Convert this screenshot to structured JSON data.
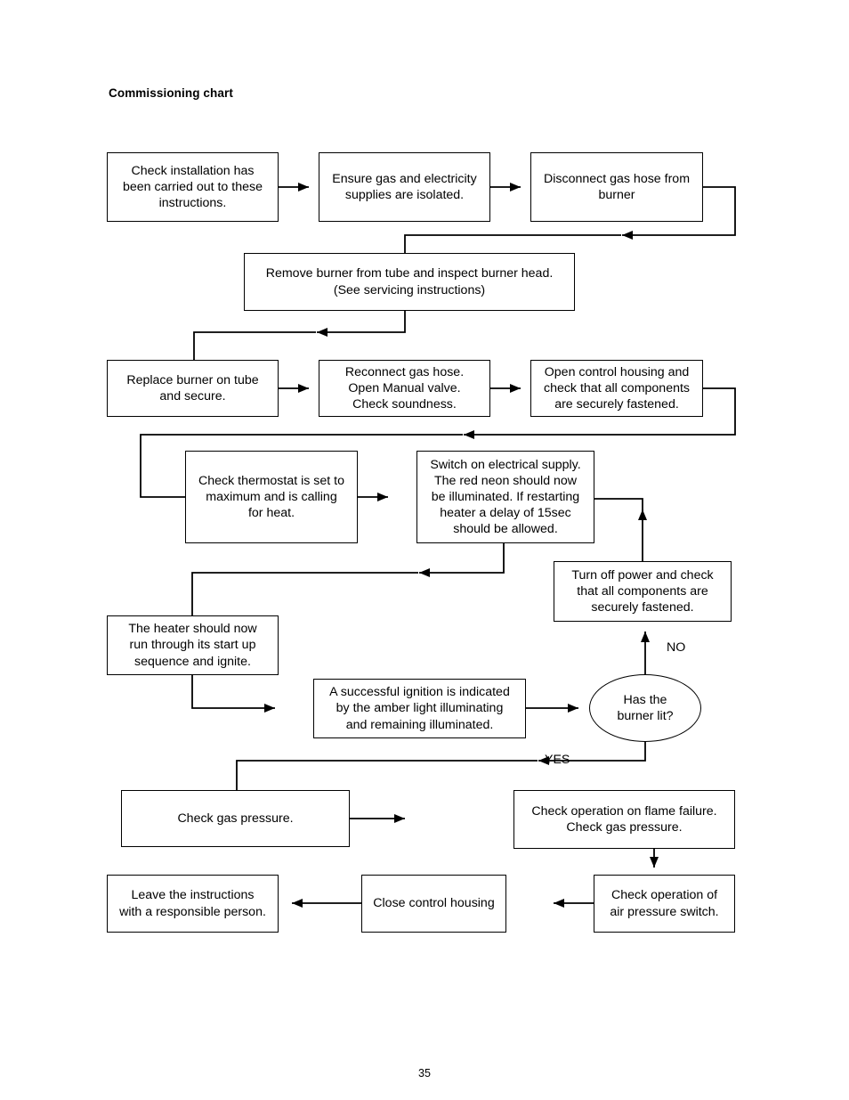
{
  "document": {
    "title": "Commissioning chart",
    "page_number": "35"
  },
  "chart_data": {
    "type": "diagram",
    "diagram_kind": "flowchart",
    "title": "Commissioning chart",
    "orientation": "top-to-bottom, serpentine rows",
    "nodes": [
      {
        "id": "n1",
        "shape": "process",
        "text": "Check installation has\nbeen carried out to these\ninstructions."
      },
      {
        "id": "n2",
        "shape": "process",
        "text": "Ensure gas and electricity\nsupplies are isolated."
      },
      {
        "id": "n3",
        "shape": "process",
        "text": "Disconnect gas hose from\nburner"
      },
      {
        "id": "n4",
        "shape": "process",
        "text": "Remove burner from tube and inspect burner head.\n(See servicing instructions)"
      },
      {
        "id": "n5",
        "shape": "process",
        "text": "Replace burner on tube\nand secure."
      },
      {
        "id": "n6",
        "shape": "process",
        "text": "Reconnect gas hose.\nOpen Manual valve.\nCheck soundness."
      },
      {
        "id": "n7",
        "shape": "process",
        "text": "Open control housing and\ncheck that all components\nare securely fastened."
      },
      {
        "id": "n8",
        "shape": "process",
        "text": "Check thermostat is set to\nmaximum and is calling\nfor heat."
      },
      {
        "id": "n9",
        "shape": "process",
        "text": "Switch on electrical supply.\nThe red neon should now\nbe illuminated. If restarting\nheater a delay of 15sec\nshould be allowed."
      },
      {
        "id": "n10",
        "shape": "process",
        "text": "Turn off power and check\nthat all components are\nsecurely fastened."
      },
      {
        "id": "n11",
        "shape": "process",
        "text": "The heater should now\nrun through its start up\nsequence and ignite."
      },
      {
        "id": "n12",
        "shape": "process",
        "text": "A successful ignition is indicated\nby the amber light illuminating\nand remaining illuminated."
      },
      {
        "id": "n13",
        "shape": "decision",
        "text": "Has the\nburner lit?"
      },
      {
        "id": "n14",
        "shape": "process",
        "text": "Check gas pressure."
      },
      {
        "id": "n15",
        "shape": "process",
        "text": "Check operation on flame failure.\nCheck gas pressure."
      },
      {
        "id": "n16",
        "shape": "process",
        "text": "Check operation of\nair pressure switch."
      },
      {
        "id": "n17",
        "shape": "process",
        "text": "Close control housing"
      },
      {
        "id": "n18",
        "shape": "process",
        "text": "Leave the instructions\nwith a responsible person."
      }
    ],
    "edges": [
      {
        "from": "n1",
        "to": "n2",
        "label": ""
      },
      {
        "from": "n2",
        "to": "n3",
        "label": ""
      },
      {
        "from": "n3",
        "to": "n4",
        "label": ""
      },
      {
        "from": "n4",
        "to": "n5",
        "label": ""
      },
      {
        "from": "n5",
        "to": "n6",
        "label": ""
      },
      {
        "from": "n6",
        "to": "n7",
        "label": ""
      },
      {
        "from": "n7",
        "to": "n8",
        "label": ""
      },
      {
        "from": "n8",
        "to": "n9",
        "label": ""
      },
      {
        "from": "n9",
        "to": "n11",
        "label": ""
      },
      {
        "from": "n10",
        "to": "n9",
        "label": ""
      },
      {
        "from": "n11",
        "to": "n12",
        "label": ""
      },
      {
        "from": "n12",
        "to": "n13",
        "label": ""
      },
      {
        "from": "n13",
        "to": "n10",
        "label": "NO"
      },
      {
        "from": "n13",
        "to": "n14",
        "label": "YES"
      },
      {
        "from": "n14",
        "to": "n15",
        "label": ""
      },
      {
        "from": "n15",
        "to": "n16",
        "label": ""
      },
      {
        "from": "n16",
        "to": "n17",
        "label": ""
      },
      {
        "from": "n17",
        "to": "n18",
        "label": ""
      }
    ],
    "edge_labels": [
      "NO",
      "YES"
    ],
    "colors": {
      "stroke": "#000000",
      "fill": "#ffffff",
      "text": "#000000"
    }
  },
  "labels": {
    "no": "NO",
    "yes": "YES"
  }
}
